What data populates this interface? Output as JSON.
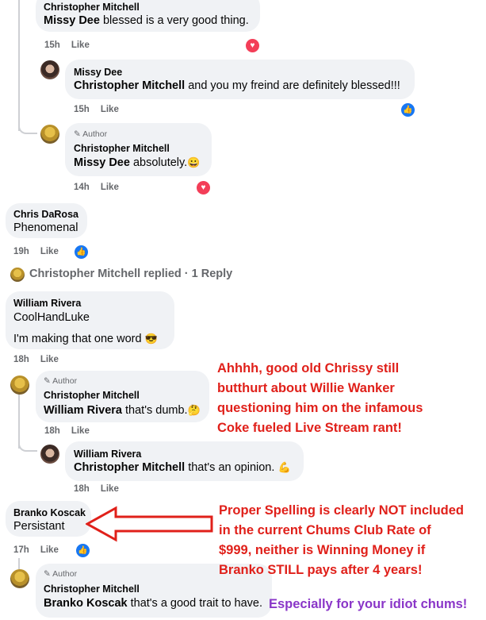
{
  "comments": {
    "c1": {
      "name": "Christopher Mitchell",
      "mention": "Missy Dee",
      "text": " blessed is a very good thing.",
      "time": "15h",
      "like": "Like"
    },
    "c2": {
      "name": "Missy Dee",
      "mention": "Christopher Mitchell",
      "text": " and you my freind are definitely blessed!!!",
      "time": "15h",
      "like": "Like"
    },
    "c3": {
      "author_badge": "Author",
      "name": "Christopher Mitchell",
      "mention": "Missy Dee",
      "text": " absolutely.",
      "emoji": "😀",
      "time": "14h",
      "like": "Like"
    },
    "c4": {
      "name": "Chris DaRosa",
      "text": "Phenomenal",
      "time": "19h",
      "like": "Like"
    },
    "replied_line": "Christopher Mitchell replied · 1 Reply",
    "c5": {
      "name": "William Rivera",
      "line1": "CoolHandLuke",
      "line2": "I'm making that one word",
      "emoji": "😎",
      "time": "18h",
      "like": "Like"
    },
    "c6": {
      "author_badge": "Author",
      "name": "Christopher Mitchell",
      "mention": "William Rivera",
      "text": " that's dumb.",
      "emoji": "🤔",
      "time": "18h",
      "like": "Like"
    },
    "c7": {
      "name": "William Rivera",
      "mention": "Christopher Mitchell",
      "text": " that's an opinion.",
      "emoji": "💪",
      "time": "18h",
      "like": "Like"
    },
    "c8": {
      "name": "Branko Koscak",
      "text": "Persistant",
      "time": "17h",
      "like": "Like"
    },
    "c9": {
      "author_badge": "Author",
      "name": "Christopher Mitchell",
      "mention": "Branko Koscak",
      "text": " that's a good trait to have."
    }
  },
  "annotations": {
    "block1": [
      "Ahhhh, good old Chrissy still",
      "butthurt about Willie Wanker",
      "questioning him on the infamous",
      "Coke fueled Live Stream rant!"
    ],
    "block2": [
      "Proper Spelling is clearly NOT included",
      "in the current Chums Club Rate of",
      "$999, neither is Winning Money if",
      "Branko STILL pays after 4 years!"
    ],
    "purple": "Especially for your idiot chums!"
  },
  "colors": {
    "annotation_red": "#e0201a",
    "annotation_purple": "#8a36c8",
    "bubble": "#f0f2f5",
    "like_blue": "#1877f2",
    "heart": "#f33e58"
  },
  "icons": {
    "heart": "heart-react-icon",
    "thumb": "thumbs-up-react-icon",
    "author": "pencil-icon"
  }
}
